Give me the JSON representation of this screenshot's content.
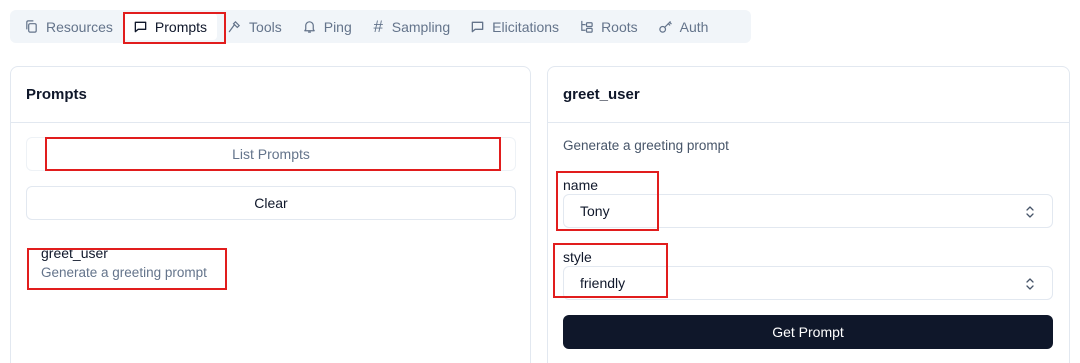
{
  "tabs": [
    {
      "label": "Resources",
      "icon": "file-copy-icon",
      "active": false
    },
    {
      "label": "Prompts",
      "icon": "message-square-icon",
      "active": true
    },
    {
      "label": "Tools",
      "icon": "hammer-icon",
      "active": false
    },
    {
      "label": "Ping",
      "icon": "bell-icon",
      "active": false
    },
    {
      "label": "Sampling",
      "icon": "hash-icon",
      "active": false
    },
    {
      "label": "Elicitations",
      "icon": "message-square-icon",
      "active": false
    },
    {
      "label": "Roots",
      "icon": "folder-tree-icon",
      "active": false
    },
    {
      "label": "Auth",
      "icon": "key-icon",
      "active": false
    }
  ],
  "left_panel": {
    "title": "Prompts",
    "list_button": "List Prompts",
    "clear_button": "Clear",
    "items": [
      {
        "name": "greet_user",
        "description": "Generate a greeting prompt"
      }
    ]
  },
  "right_panel": {
    "title": "greet_user",
    "description": "Generate a greeting prompt",
    "fields": [
      {
        "label": "name",
        "value": "Tony"
      },
      {
        "label": "style",
        "value": "friendly"
      }
    ],
    "submit_button": "Get Prompt"
  },
  "colors": {
    "highlight": "#e11d1d",
    "primary": "#0f172a",
    "muted": "#64748b"
  }
}
